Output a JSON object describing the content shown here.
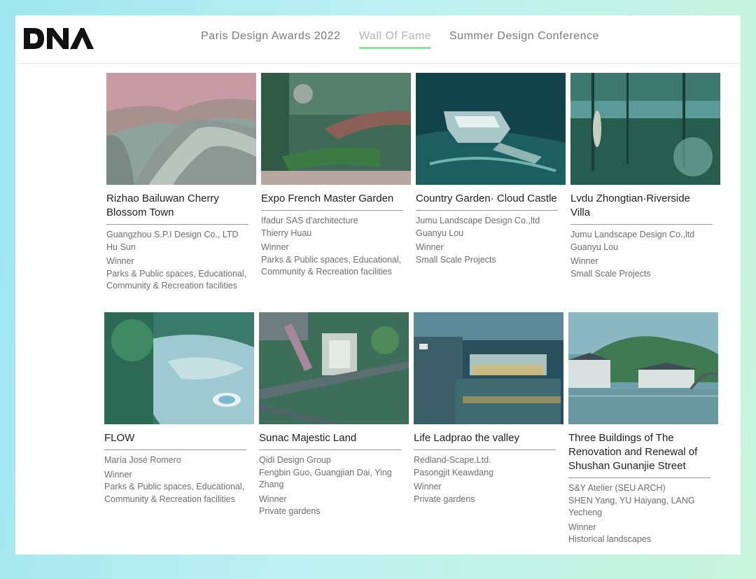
{
  "brand": {
    "logo_text": "DNA"
  },
  "nav": {
    "items": [
      {
        "label": "Paris Design Awards 2022",
        "active": false
      },
      {
        "label": "Wall Of Fame",
        "active": true
      },
      {
        "label": "Summer Design Conference",
        "active": false
      }
    ]
  },
  "projects": [
    {
      "title": "Rizhao Bailuwan Cherry Blossom Town",
      "studio": "Guangzhou S.P.I Design Co., LTD",
      "designers": "Hu Sun",
      "result": "Winner",
      "category": "Parks & Public spaces, Educational, Community & Recreation facilities"
    },
    {
      "title": "Expo French Master Garden",
      "studio": "Ifadur SAS d'architecture",
      "designers": "Thierry Huau",
      "result": "Winner",
      "category": "Parks & Public spaces, Educational, Community & Recreation facilities"
    },
    {
      "title": "Country Garden· Cloud Castle",
      "studio": "Jumu Landscape Design Co.,ltd",
      "designers": "Guanyu Lou",
      "result": "Winner",
      "category": "Small Scale Projects"
    },
    {
      "title": "Lvdu Zhongtian·Riverside Villa",
      "studio": "Jumu Landscape Design Co.,ltd",
      "designers": "Guanyu Lou",
      "result": "Winner",
      "category": "Small Scale Projects"
    },
    {
      "title": "FLOW",
      "studio": "María José Romero",
      "designers": "",
      "result": "Winner",
      "category": "Parks & Public spaces, Educational, Community & Recreation facilities"
    },
    {
      "title": "Sunac Majestic Land",
      "studio": "Qidi Design Group",
      "designers": "Fengbin Guo, Guangjian Dai, Ying Zhang",
      "result": "Winner",
      "category": "Private gardens"
    },
    {
      "title": "Life Ladprao the valley",
      "studio": "Redland-Scape.Ltd.",
      "designers": "Pasongjit Keawdang",
      "result": "Winner",
      "category": "Private gardens"
    },
    {
      "title": "Three Buildings of The Renovation and Renewal of Shushan Gunanjie Street",
      "studio": "S&Y Atelier (SEU ARCH)",
      "designers": "SHEN Yang, YU Haiyang, LANG Yecheng",
      "result": "Winner",
      "category": "Historical landscapes"
    }
  ]
}
